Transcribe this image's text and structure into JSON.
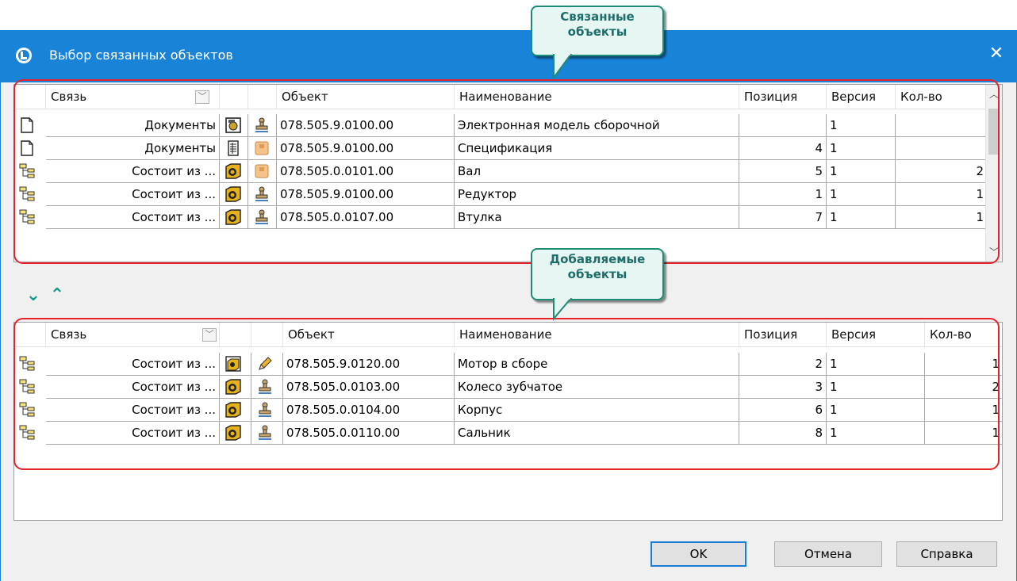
{
  "window": {
    "title": "Выбор связанных объектов"
  },
  "callouts": {
    "top": "Связанные\nобъекты",
    "bottom": "Добавляемые\nобъекты"
  },
  "top_grid": {
    "columns": {
      "link": "Связь",
      "object": "Объект",
      "name": "Наименование",
      "position": "Позиция",
      "version": "Версия",
      "qty": "Кол-во"
    },
    "rows": [
      {
        "link": "Документы",
        "type_icon": "assembly-doc-icon",
        "state_icon": "stamp-icon",
        "object": "078.505.9.0100.00",
        "name": "Электронная модель сборочной",
        "position": "",
        "version": "1",
        "qty": ""
      },
      {
        "link": "Документы",
        "type_icon": "spec-doc-icon",
        "state_icon": "folder-icon",
        "object": "078.505.9.0100.00",
        "name": "Спецификация",
        "position": "4",
        "version": "1",
        "qty": ""
      },
      {
        "link": "Состоит из ...",
        "type_icon": "part-icon",
        "state_icon": "folder-icon",
        "object": "078.505.0.0101.00",
        "name": "Вал",
        "position": "5",
        "version": "1",
        "qty": "2"
      },
      {
        "link": "Состоит из ...",
        "type_icon": "part-icon",
        "state_icon": "stamp-icon",
        "object": "078.505.9.0100.00",
        "name": "Редуктор",
        "position": "1",
        "version": "1",
        "qty": "1"
      },
      {
        "link": "Состоит из ...",
        "type_icon": "part-icon",
        "state_icon": "stamp-icon",
        "object": "078.505.0.0107.00",
        "name": "Втулка",
        "position": "7",
        "version": "1",
        "qty": "1"
      }
    ]
  },
  "bottom_grid": {
    "columns": {
      "link": "Связь",
      "object": "Объект",
      "name": "Наименование",
      "position": "Позиция",
      "version": "Версия",
      "qty": "Кол-во"
    },
    "rows": [
      {
        "link": "Состоит из ...",
        "type_icon": "assembly-icon",
        "state_icon": "pencil-icon",
        "object": "078.505.9.0120.00",
        "name": "Мотор в сборе",
        "position": "2",
        "version": "1",
        "qty": "1"
      },
      {
        "link": "Состоит из ...",
        "type_icon": "part-icon",
        "state_icon": "stamp-icon",
        "object": "078.505.0.0103.00",
        "name": "Колесо зубчатое",
        "position": "3",
        "version": "1",
        "qty": "2"
      },
      {
        "link": "Состоит из ...",
        "type_icon": "part-icon",
        "state_icon": "stamp-icon",
        "object": "078.505.0.0104.00",
        "name": "Корпус",
        "position": "6",
        "version": "1",
        "qty": "1"
      },
      {
        "link": "Состоит из ...",
        "type_icon": "part-icon",
        "state_icon": "stamp-icon",
        "object": "078.505.0.0110.00",
        "name": "Сальник",
        "position": "8",
        "version": "1",
        "qty": "1"
      }
    ]
  },
  "buttons": {
    "ok": "OK",
    "cancel": "Отмена",
    "help": "Справка"
  },
  "colors": {
    "accent": "#1983d8",
    "highlight": "#e8202a",
    "callout_border": "#1e8b76",
    "arrow": "#14998a"
  }
}
